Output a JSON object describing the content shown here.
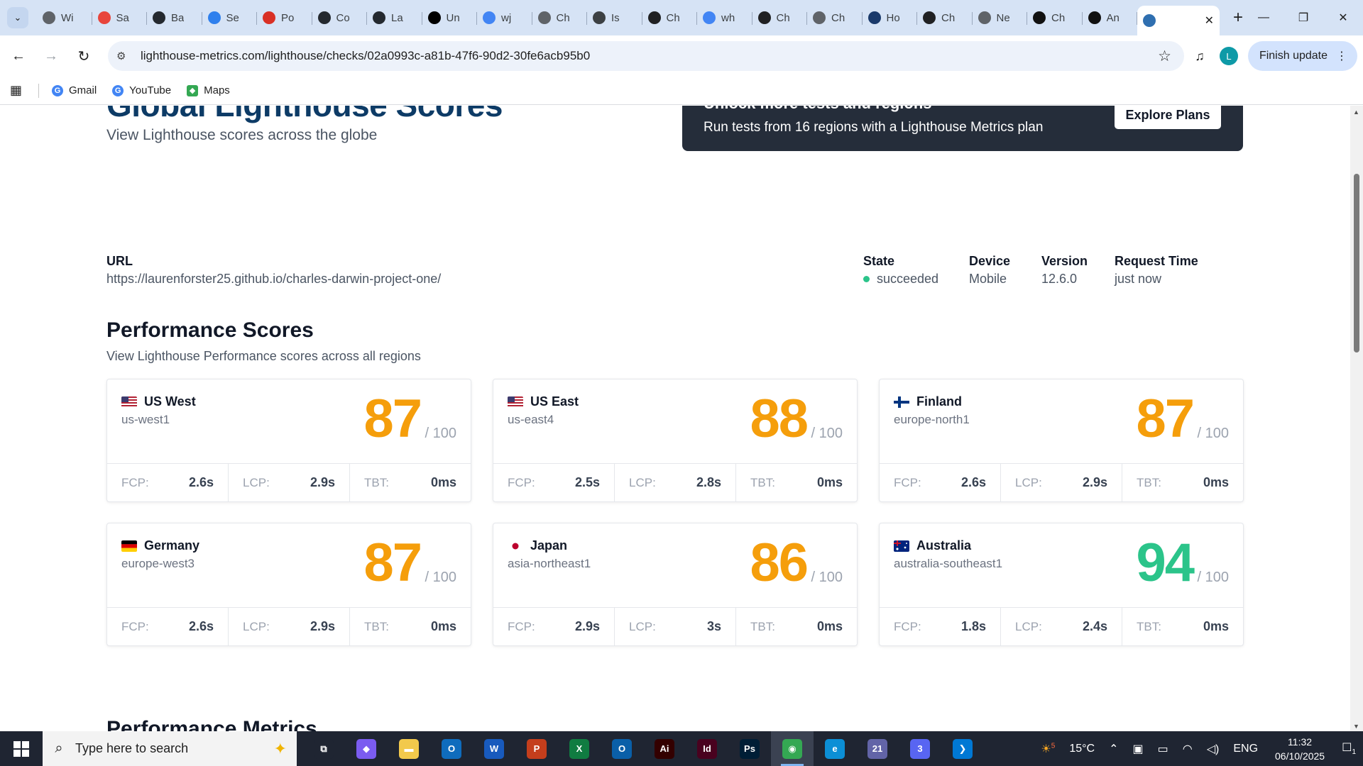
{
  "browser": {
    "tabs": [
      {
        "title": "Wi",
        "icon": "chrome-icon",
        "color": "#5f6368"
      },
      {
        "title": "Sa",
        "icon": "record-icon",
        "color": "#e8453c"
      },
      {
        "title": "Ba",
        "icon": "github-icon",
        "color": "#24292f"
      },
      {
        "title": "Se",
        "icon": "grid-icon",
        "color": "#2f80ed"
      },
      {
        "title": "Po",
        "icon": "gmail-icon",
        "color": "#d93025"
      },
      {
        "title": "Co",
        "icon": "github-icon",
        "color": "#24292f"
      },
      {
        "title": "La",
        "icon": "github-icon",
        "color": "#24292f"
      },
      {
        "title": "Un",
        "icon": "medium-icon",
        "color": "#000000"
      },
      {
        "title": "wj",
        "icon": "google-icon",
        "color": "#4285f4"
      },
      {
        "title": "Ch",
        "icon": "globe-icon",
        "color": "#5f6368"
      },
      {
        "title": "Is",
        "icon": "stack-icon",
        "color": "#3c4043"
      },
      {
        "title": "Ch",
        "icon": "openai-icon",
        "color": "#202123"
      },
      {
        "title": "wh",
        "icon": "google-icon",
        "color": "#4285f4"
      },
      {
        "title": "Ch",
        "icon": "openai-icon",
        "color": "#202123"
      },
      {
        "title": "Ch",
        "icon": "globe-icon",
        "color": "#5f6368"
      },
      {
        "title": "Ho",
        "icon": "trophy-icon",
        "color": "#1a3a6b"
      },
      {
        "title": "Ch",
        "icon": "openai-icon",
        "color": "#202123"
      },
      {
        "title": "Ne",
        "icon": "chrome-icon",
        "color": "#5f6368"
      },
      {
        "title": "Ch",
        "icon": "swirl-icon",
        "color": "#111111"
      },
      {
        "title": "An",
        "icon": "u-icon",
        "color": "#111111"
      }
    ],
    "active_tab": {
      "icon": "lighthouse-icon",
      "close": "✕"
    },
    "new_tab": "+",
    "url": "lighthouse-metrics.com/lighthouse/checks/02a0993c-a81b-47f6-90d2-30fe6acb95b0",
    "avatar_letter": "L",
    "finish_update": "Finish update",
    "bookmarks": [
      {
        "label": "Gmail",
        "icon": "google-icon"
      },
      {
        "label": "YouTube",
        "icon": "google-icon"
      },
      {
        "label": "Maps",
        "icon": "maps-icon"
      }
    ]
  },
  "page": {
    "hero_title": "Global Lighthouse Scores",
    "hero_subtitle": "View Lighthouse scores across the globe",
    "promo": {
      "heading": "Unlock more tests and regions",
      "body": "Run tests from 16 regions with a Lighthouse Metrics plan",
      "button": "Explore Plans"
    },
    "meta": {
      "url_label": "URL",
      "url_value": "https://laurenforster25.github.io/charles-darwin-project-one/",
      "state_label": "State",
      "state_value": "succeeded",
      "device_label": "Device",
      "device_value": "Mobile",
      "version_label": "Version",
      "version_value": "12.6.0",
      "request_label": "Request Time",
      "request_value": "just now"
    },
    "performance": {
      "title": "Performance Scores",
      "subtitle": "View Lighthouse Performance scores across all regions",
      "out_of": "/ 100",
      "fcp_label": "FCP:",
      "lcp_label": "LCP:",
      "tbt_label": "TBT:",
      "regions": [
        {
          "name": "US West",
          "code": "us-west1",
          "score": "87",
          "fcp": "2.6s",
          "lcp": "2.9s",
          "tbt": "0ms",
          "score_color": "#f59e0b",
          "flag": "us"
        },
        {
          "name": "US East",
          "code": "us-east4",
          "score": "88",
          "fcp": "2.5s",
          "lcp": "2.8s",
          "tbt": "0ms",
          "score_color": "#f59e0b",
          "flag": "us"
        },
        {
          "name": "Finland",
          "code": "europe-north1",
          "score": "87",
          "fcp": "2.6s",
          "lcp": "2.9s",
          "tbt": "0ms",
          "score_color": "#f59e0b",
          "flag": "fi"
        },
        {
          "name": "Germany",
          "code": "europe-west3",
          "score": "87",
          "fcp": "2.6s",
          "lcp": "2.9s",
          "tbt": "0ms",
          "score_color": "#f59e0b",
          "flag": "de"
        },
        {
          "name": "Japan",
          "code": "asia-northeast1",
          "score": "86",
          "fcp": "2.9s",
          "lcp": "3s",
          "tbt": "0ms",
          "score_color": "#f59e0b",
          "flag": "jp"
        },
        {
          "name": "Australia",
          "code": "australia-southeast1",
          "score": "94",
          "fcp": "1.8s",
          "lcp": "2.4s",
          "tbt": "0ms",
          "score_color": "#2bc48a",
          "flag": "au"
        }
      ]
    },
    "next_section_title": "Performance Metrics"
  },
  "taskbar": {
    "search_placeholder": "Type here to search",
    "apps": [
      {
        "name": "task-view-icon",
        "label": "⧉",
        "color": "#1f2532"
      },
      {
        "name": "copilot-icon",
        "label": "◆",
        "color": "#7b5cf0"
      },
      {
        "name": "file-explorer-icon",
        "label": "▬",
        "color": "#f2c94c"
      },
      {
        "name": "outlook-icon",
        "label": "O",
        "color": "#0f6cbd"
      },
      {
        "name": "word-icon",
        "label": "W",
        "color": "#185abd"
      },
      {
        "name": "powerpoint-icon",
        "label": "P",
        "color": "#c43e1c"
      },
      {
        "name": "excel-icon",
        "label": "X",
        "color": "#107c41"
      },
      {
        "name": "outlook-classic-icon",
        "label": "O",
        "color": "#0a5fa8"
      },
      {
        "name": "illustrator-icon",
        "label": "Ai",
        "color": "#330000"
      },
      {
        "name": "indesign-icon",
        "label": "Id",
        "color": "#49021f"
      },
      {
        "name": "photoshop-icon",
        "label": "Ps",
        "color": "#001e36"
      },
      {
        "name": "chrome-icon",
        "label": "◉",
        "color": "#34a853"
      },
      {
        "name": "edge-icon",
        "label": "e",
        "color": "#0c8fd6"
      },
      {
        "name": "teams-icon",
        "label": "21",
        "color": "#6264a7"
      },
      {
        "name": "discord-icon",
        "label": "3",
        "color": "#5865f2"
      },
      {
        "name": "vscode-icon",
        "label": "❯",
        "color": "#0078d4"
      }
    ],
    "weather_badge": "5",
    "temperature": "15°C",
    "language": "ENG",
    "time": "11:32",
    "date": "06/10/2025",
    "notifications": "1"
  }
}
